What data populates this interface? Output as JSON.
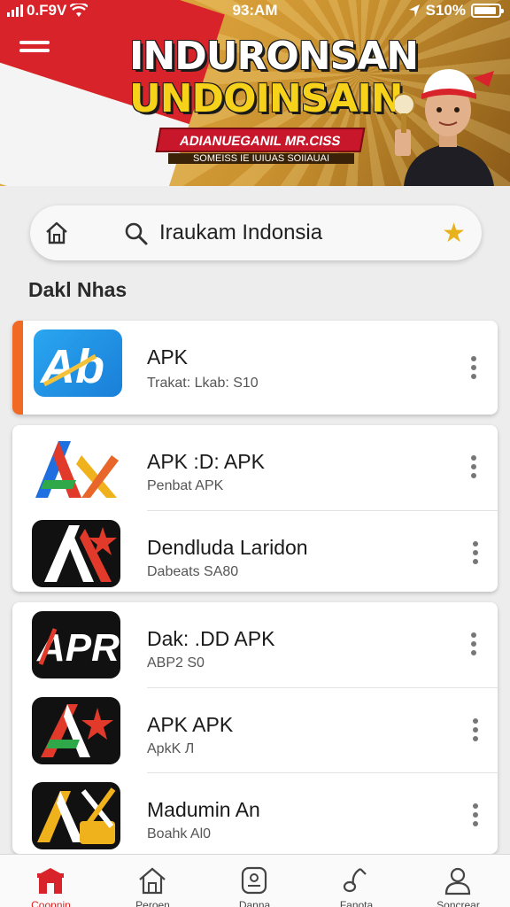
{
  "status_bar": {
    "carrier": "0.F9V",
    "time": "93:AM",
    "battery": "S10%"
  },
  "banner": {
    "title_line1": "INDURONSAN",
    "title_line2": "UNDOINSAIN",
    "ribbon": "ADIANUEGANIL MR.CISS",
    "small": "SOMEISS IE IUIUAS SOIIAUAI"
  },
  "search": {
    "value": "Iraukam Indonsia"
  },
  "section": {
    "title": "Dakl Nhas"
  },
  "cards": [
    {
      "items": [
        {
          "name": "APK",
          "sub": "Trakat: Lkab: S10",
          "icon": "ab-app-icon"
        }
      ]
    },
    {
      "items": [
        {
          "name": "APK :D: APK",
          "sub": "Penbat APK",
          "icon": "colorful-a-icon"
        },
        {
          "name": "Dendluda Laridon",
          "sub": "Dabeats SA80",
          "icon": "a-star-icon"
        }
      ]
    },
    {
      "items": [
        {
          "name": "Dak: .DD APK",
          "sub": "ABP2 S0",
          "icon": "apr-icon"
        },
        {
          "name": "APK APK",
          "sub": "ApkK Л",
          "icon": "a-star-red-icon"
        },
        {
          "name": "Madumin An",
          "sub": "Boahk Al0",
          "icon": "a-tools-icon"
        }
      ]
    }
  ],
  "bottom_nav": [
    {
      "label": "Coonnin",
      "icon": "store-icon",
      "active": true
    },
    {
      "label": "Peroen",
      "icon": "home-icon",
      "active": false
    },
    {
      "label": "Danna",
      "icon": "message-icon",
      "active": false
    },
    {
      "label": "Fanota",
      "icon": "music-icon",
      "active": false
    },
    {
      "label": "Soncrear",
      "icon": "profile-icon",
      "active": false
    }
  ],
  "colors": {
    "accent": "#d8232a",
    "highlight": "#f06a24",
    "star": "#e7b21c"
  }
}
